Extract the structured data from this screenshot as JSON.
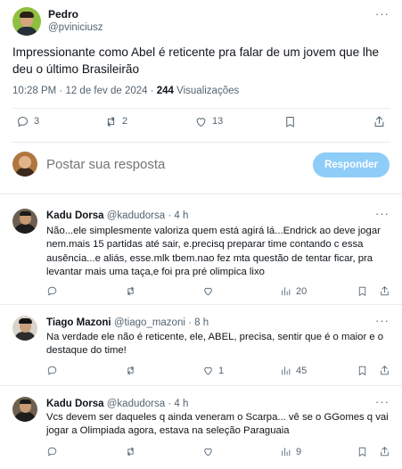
{
  "tweet": {
    "author_name": "Pedro",
    "author_handle": "@pviniciusz",
    "more": "···",
    "text": "Impressionante como Abel é reticente pra falar de um jovem que lhe deu o último Brasileirão",
    "time": "10:28 PM · 12 de fev de 2024 · ",
    "views_count": "244",
    "views_label": " Visualizações",
    "replies": "3",
    "retweets": "2",
    "likes": "13"
  },
  "composer": {
    "placeholder": "Postar sua resposta",
    "button": "Responder"
  },
  "replies": [
    {
      "name": "Kadu Dorsa",
      "handle": "@kadudorsa",
      "time": "· 4 h",
      "text": "Não...ele simplesmente valoriza quem está agirá lá...Endrick  ao deve jogar nem.mais 15 partidas até sair, e.precisq preparar time contando c essa ausência...e aliás, esse.mlk tbem.nao fez mta questão de tentar ficar, pra levantar mais uma taça,e foi pra pré olimpica lixo",
      "replies": "",
      "retweets": "",
      "likes": "",
      "views": "20"
    },
    {
      "name": "Tiago Mazoni",
      "handle": "@tiago_mazoni",
      "time": "· 8 h",
      "text": "Na verdade ele não é reticente, ele, ABEL, precisa, sentir que é o maior e o destaque do time!",
      "replies": "",
      "retweets": "",
      "likes": "1",
      "views": "45"
    },
    {
      "name": "Kadu Dorsa",
      "handle": "@kadudorsa",
      "time": "· 4 h",
      "text": "Vcs devem ser daqueles q ainda veneram o Scarpa... vê se o GGomes q vai jogar a Olimpiada agora, estava na seleção Paraguaia",
      "replies": "",
      "retweets": "",
      "likes": "",
      "views": "9"
    }
  ],
  "colors": {
    "text": "#0f1419",
    "secondary": "#536471",
    "divider": "#e6ecf0",
    "reply_button": "#8ecdf7"
  },
  "icons": [
    "reply-icon",
    "retweet-icon",
    "like-icon",
    "bookmark-icon",
    "share-icon",
    "views-icon",
    "more-icon"
  ]
}
